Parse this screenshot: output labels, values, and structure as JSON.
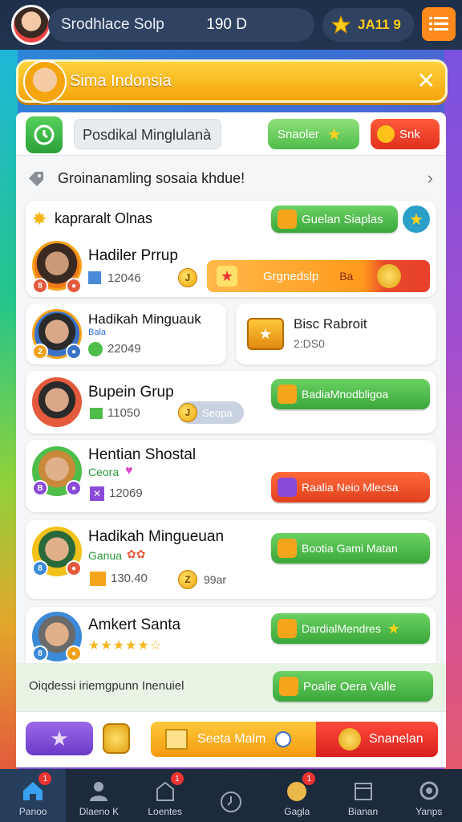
{
  "topbar": {
    "player_name": "Srodhlace Solp",
    "level": "190 D",
    "coins": "JA11 9",
    "menu_icon": "menu-icon"
  },
  "banner": {
    "text": "Sima Indonsia",
    "close_icon": "close-icon"
  },
  "search": {
    "placeholder": "Posdikal Minglulanà",
    "search_button": "Snaoler",
    "red_button": "Snk"
  },
  "info": {
    "text": "Groinanamling sosaia khdue!"
  },
  "section": {
    "title": "kapraralt Olnas",
    "button": "Guelan Siaplas"
  },
  "players": [
    {
      "name": "Hadiler Prrup",
      "stat": "12046",
      "button": "Grgnedslp",
      "bar_tag": "Ba"
    },
    {
      "name": "Hadikah Minguauk",
      "stat": "22049",
      "tag": "Bala",
      "side_title": "Bisc Rabroit",
      "side_sub": "2:DS0"
    },
    {
      "name": "Bupein Grup",
      "stat": "11050",
      "coin_label": "Seopa",
      "button": "BadiaMnodbligoa"
    },
    {
      "name": "Hentian Shostal",
      "tag": "Ceora",
      "stat": "12069",
      "button": "Raalia Neio Mlecsa"
    },
    {
      "name": "Hadikah Mingueuan",
      "tag": "Ganua",
      "stat": "130.40",
      "coin_sub": "99ar",
      "button": "Bootia Gami Matan"
    },
    {
      "name": "Amkert Santa",
      "rating": "★★★★★☆",
      "button": "DardialMendres"
    }
  ],
  "footer_row": {
    "text": "Oiqdessi iriemgpunn Inenuiel",
    "button": "Poalie Oera Valle"
  },
  "bottom_actions": {
    "center_button": "Seeta Malm",
    "right_button": "Snanelan"
  },
  "nav": [
    {
      "label": "Panoo",
      "badge": "1"
    },
    {
      "label": "Dlaeno K",
      "badge": ""
    },
    {
      "label": "Loentes",
      "badge": "1"
    },
    {
      "label": "",
      "badge": ""
    },
    {
      "label": "Gagla",
      "badge": "1"
    },
    {
      "label": "Bianan",
      "badge": ""
    },
    {
      "label": "Yanps",
      "badge": ""
    }
  ],
  "colors": {
    "accent_green": "#4fbd4a",
    "accent_red": "#e0401d",
    "accent_yellow": "#f5a50d",
    "nav_bg": "#1d2a3c"
  }
}
